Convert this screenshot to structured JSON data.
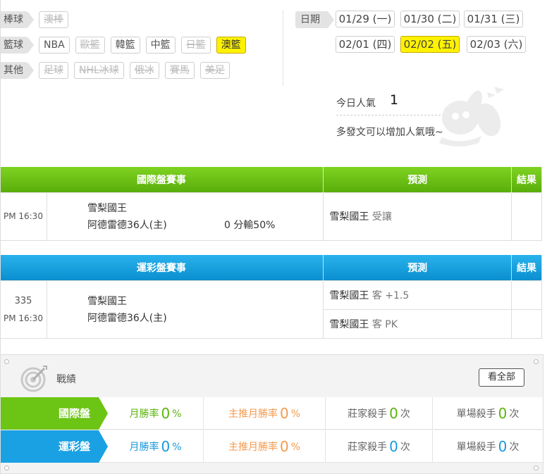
{
  "categories": [
    {
      "label": "棒球",
      "items": [
        {
          "text": "澳棒",
          "state": "disabled"
        }
      ]
    },
    {
      "label": "籃球",
      "items": [
        {
          "text": "NBA",
          "state": "normal"
        },
        {
          "text": "歐籃",
          "state": "disabled"
        },
        {
          "text": "韓籃",
          "state": "normal"
        },
        {
          "text": "中籃",
          "state": "normal"
        },
        {
          "text": "日籃",
          "state": "disabled"
        },
        {
          "text": "澳籃",
          "state": "selected"
        }
      ]
    },
    {
      "label": "其他",
      "items": [
        {
          "text": "足球",
          "state": "disabled"
        },
        {
          "text": "NHL冰球",
          "state": "disabled"
        },
        {
          "text": "俄冰",
          "state": "disabled"
        },
        {
          "text": "賽馬",
          "state": "disabled"
        },
        {
          "text": "美足",
          "state": "disabled"
        }
      ]
    }
  ],
  "dates": {
    "label": "日期",
    "items": [
      "01/29 (一)",
      "01/30 (二)",
      "01/31 (三)",
      "02/01 (四)",
      "02/02 (五)",
      "02/03 (六)"
    ],
    "selected_index": 4
  },
  "popularity": {
    "label": "今日人氣",
    "value": "1",
    "message": "多發文可以增加人氣哦~"
  },
  "intl_table": {
    "headers": [
      "國際盤賽事",
      "預測",
      "結果"
    ],
    "rows": [
      {
        "time": "PM 16:30",
        "team_away": "雪梨國王",
        "team_home": "阿德雷德36人(主)",
        "line": "0 分輸50%",
        "prediction_team": "雪梨國王",
        "prediction_pick": "受讓",
        "result": ""
      }
    ]
  },
  "lottery_table": {
    "headers": [
      "運彩盤賽事",
      "預測",
      "結果"
    ],
    "rows": [
      {
        "number": "335",
        "time": "PM 16:30",
        "team_away": "雪梨國王",
        "team_home": "阿德雷德36人(主)",
        "predictions": [
          {
            "team": "雪梨國王",
            "pick": "客 +1.5",
            "result": ""
          },
          {
            "team": "雪梨國王",
            "pick": "客 PK",
            "result": ""
          }
        ]
      }
    ]
  },
  "record": {
    "title": "戰績",
    "view_all": "看全部",
    "rows": [
      {
        "label": "國際盤",
        "color": "#6cc414",
        "stats": [
          {
            "label": "月勝率",
            "value": "0",
            "unit": "%"
          },
          {
            "label": "主推月勝率",
            "value": "0",
            "unit": "%"
          },
          {
            "label": "莊家殺手",
            "value": "0",
            "unit": "次"
          },
          {
            "label": "單場殺手",
            "value": "0",
            "unit": "次"
          }
        ]
      },
      {
        "label": "運彩盤",
        "color": "#1aa1e3",
        "stats": [
          {
            "label": "月勝率",
            "value": "0",
            "unit": "%"
          },
          {
            "label": "主推月勝率",
            "value": "0",
            "unit": "%"
          },
          {
            "label": "莊家殺手",
            "value": "0",
            "unit": "次"
          },
          {
            "label": "單場殺手",
            "value": "0",
            "unit": "次"
          }
        ]
      }
    ]
  }
}
